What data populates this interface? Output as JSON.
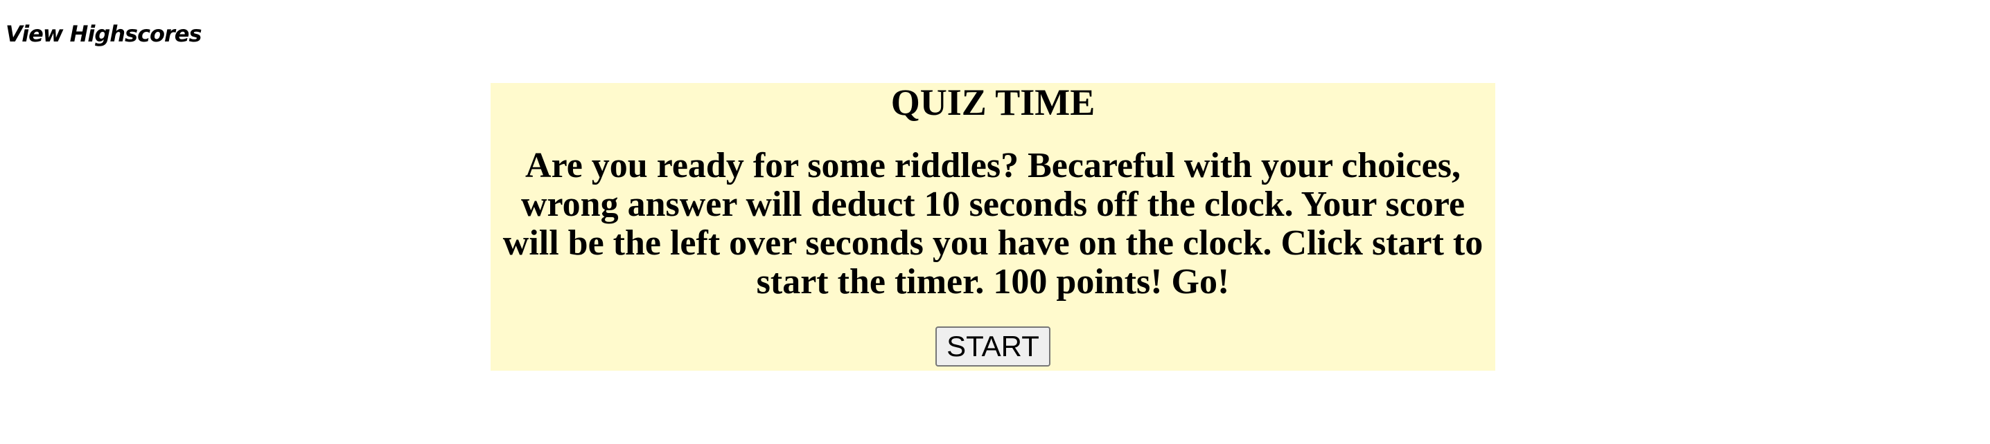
{
  "header": {
    "highscores_label": "View Highscores"
  },
  "quiz": {
    "title": "QUIZ TIME",
    "intro": "Are you ready for some riddles? Becareful with your choices, wrong answer will deduct 10 seconds off the clock. Your score will be the left over seconds you have on the clock. Click start to start the timer. 100 points! Go!",
    "start_label": "START"
  },
  "colors": {
    "card_background": "#fffacd",
    "page_background": "#ffffff",
    "text": "#000000"
  }
}
